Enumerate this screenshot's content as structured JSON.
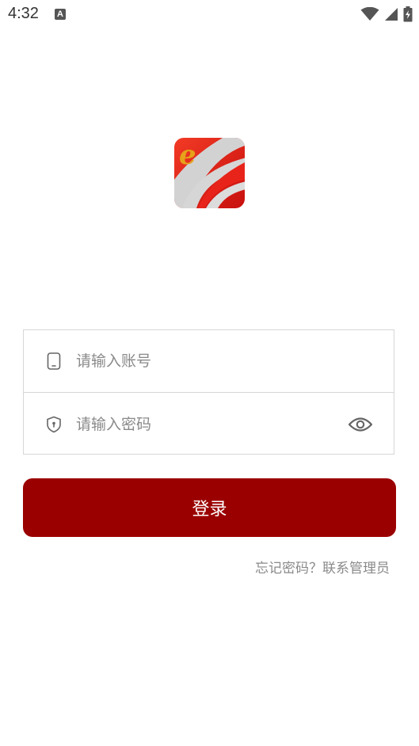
{
  "status_bar": {
    "time": "4:32",
    "notification_icon": "a-icon",
    "notification_letter": "A",
    "icons": [
      "wifi-icon",
      "signal-icon",
      "battery-icon"
    ]
  },
  "logo": {
    "icon": "app-logo",
    "letter": "e",
    "colors": {
      "red": "#e8241a",
      "gold": "#e5a21a",
      "gray": "#d0d0d0"
    }
  },
  "form": {
    "account": {
      "placeholder": "请输入账号",
      "value": "",
      "icon": "phone-icon"
    },
    "password": {
      "placeholder": "请输入密码",
      "value": "",
      "icon": "shield-icon",
      "toggle_icon": "eye-icon"
    }
  },
  "login_button": {
    "label": "登录",
    "color": "#9b0000"
  },
  "forgot_link": {
    "label": "忘记密码？联系管理员"
  }
}
